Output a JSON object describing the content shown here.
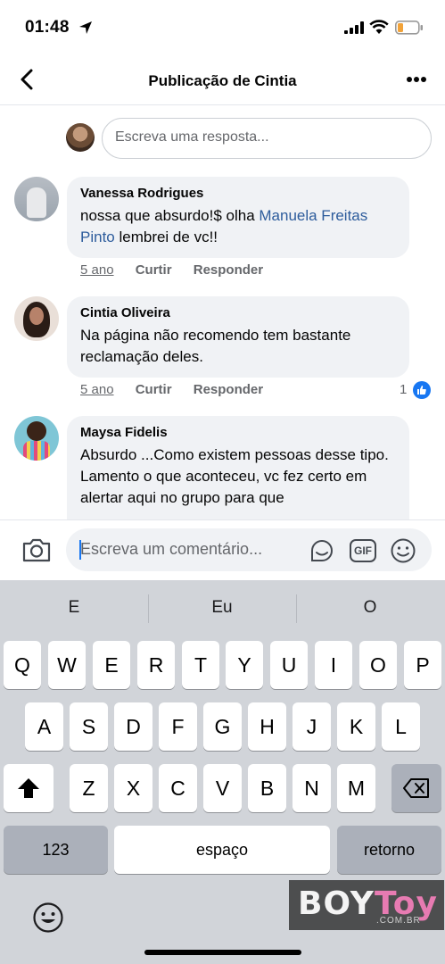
{
  "status_bar": {
    "time": "01:48"
  },
  "nav": {
    "title": "Publicação de Cintia"
  },
  "reply_box": {
    "placeholder": "Escreva uma resposta..."
  },
  "comments": [
    {
      "author": "Vanessa Rodrigues",
      "text_before": "nossa que absurdo!$ olha ",
      "mention": "Manuela Freitas Pinto",
      "text_after": " lembrei de vc!!",
      "time": "5 ano",
      "like_label": "Curtir",
      "reply_label": "Responder"
    },
    {
      "author": "Cintia Oliveira",
      "text": "Na página não recomendo  tem bastante reclamação deles.",
      "time": "5 ano",
      "like_label": "Curtir",
      "reply_label": "Responder",
      "reaction_count": "1",
      "reaction_type": "like"
    },
    {
      "author": "Maysa Fidelis",
      "text": "Absurdo ...Como existem pessoas desse tipo. Lamento o que aconteceu, vc fez certo em alertar aqui no grupo para que"
    }
  ],
  "composer": {
    "placeholder": "Escreva um comentário...",
    "gif_label": "GIF"
  },
  "keyboard": {
    "suggestions": [
      "E",
      "Eu",
      "O"
    ],
    "row1": [
      "Q",
      "W",
      "E",
      "R",
      "T",
      "Y",
      "U",
      "I",
      "O",
      "P"
    ],
    "row2": [
      "A",
      "S",
      "D",
      "F",
      "G",
      "H",
      "J",
      "K",
      "L"
    ],
    "row3": [
      "Z",
      "X",
      "C",
      "V",
      "B",
      "N",
      "M"
    ],
    "numbers_label": "123",
    "space_label": "espaço",
    "return_label": "retorno"
  },
  "watermark": {
    "boy": "BOY",
    "toy": "Toy",
    "domain": ".COM.BR"
  },
  "colors": {
    "accent": "#1877f2",
    "mention": "#2d5c9c",
    "bubble": "#f0f2f5",
    "keyboard": "#d1d4d9"
  }
}
